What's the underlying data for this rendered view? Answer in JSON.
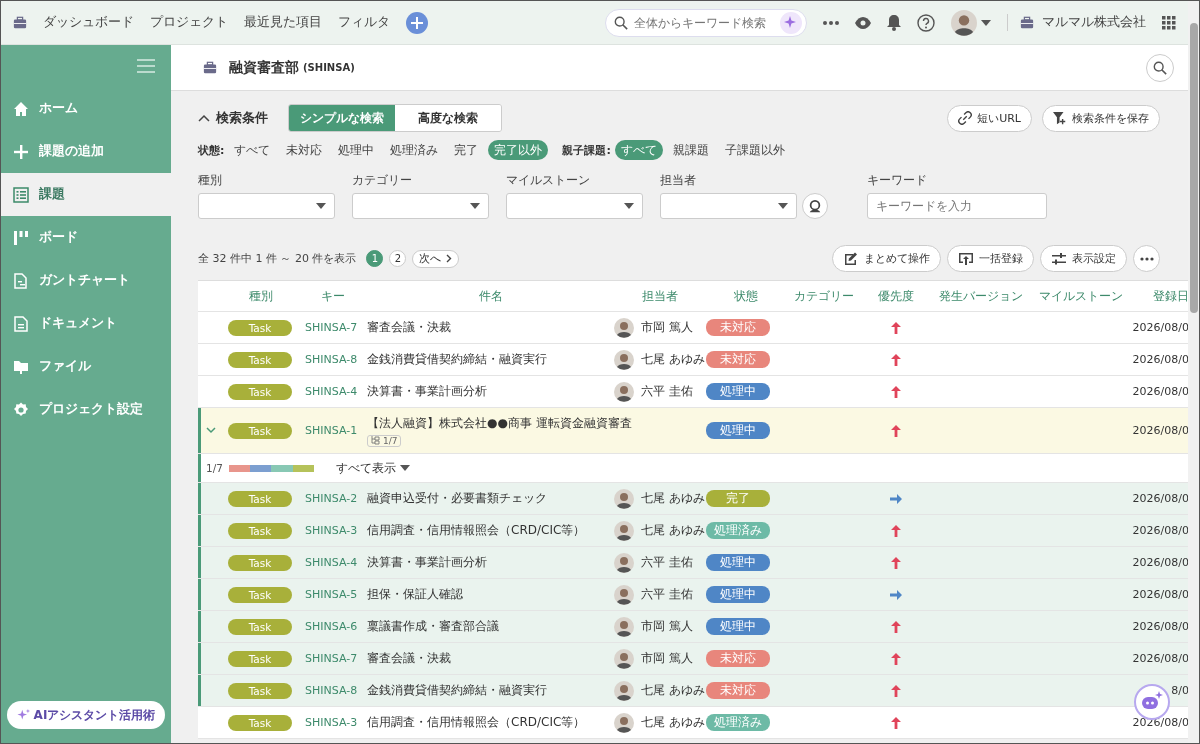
{
  "topbar": {
    "links": [
      "ダッシュボード",
      "プロジェクト",
      "最近見た項目",
      "フィルタ"
    ],
    "search": {
      "placeholder": "全体からキーワード検索"
    },
    "company": "マルマル株式会社"
  },
  "sidebar": {
    "items": [
      {
        "label": "ホーム",
        "kind": "home",
        "selected": false
      },
      {
        "label": "課題の追加",
        "kind": "add",
        "selected": false
      },
      {
        "label": "課題",
        "kind": "list",
        "selected": true
      },
      {
        "label": "ボード",
        "kind": "board",
        "selected": false
      },
      {
        "label": "ガントチャート",
        "kind": "gantt",
        "selected": false
      },
      {
        "label": "ドキュメント",
        "kind": "document",
        "selected": false
      },
      {
        "label": "ファイル",
        "kind": "file",
        "selected": false
      },
      {
        "label": "プロジェクト設定",
        "kind": "settings",
        "selected": false
      }
    ],
    "assistant": "AIアシスタント活用術"
  },
  "project": {
    "name": "融資審査部",
    "key": "(SHINSA)"
  },
  "search": {
    "title": "検索条件",
    "expanded": true,
    "modes": [
      {
        "label": "シンプルな検索",
        "selected": true
      },
      {
        "label": "高度な検索",
        "selected": false
      }
    ],
    "actions": [
      "短いURL",
      "検索条件を保存"
    ],
    "status_label": "状態:",
    "statuses": [
      {
        "label": "すべて",
        "selected": false
      },
      {
        "label": "未対応",
        "selected": false
      },
      {
        "label": "処理中",
        "selected": false
      },
      {
        "label": "処理済み",
        "selected": false
      },
      {
        "label": "完了",
        "selected": false
      },
      {
        "label": "完了以外",
        "selected": true
      }
    ],
    "parent_label": "親子課題:",
    "parents": [
      {
        "label": "すべて",
        "selected": true
      },
      {
        "label": "親課題",
        "selected": false
      },
      {
        "label": "子課題以外",
        "selected": false
      }
    ],
    "selects": [
      "種別",
      "カテゴリー",
      "マイルストーン",
      "担当者"
    ],
    "keyword": {
      "label": "キーワード",
      "placeholder": "キーワードを入力"
    }
  },
  "pager": {
    "summary": "全 32 件中 1 件 ～ 20 件を表示",
    "pages": [
      {
        "label": "1",
        "selected": true
      },
      {
        "label": "2",
        "selected": false
      }
    ],
    "next": "次へ"
  },
  "toolbar": [
    {
      "label": "まとめて操作",
      "kind": "edit"
    },
    {
      "label": "一括登録",
      "kind": "upload"
    },
    {
      "label": "表示設定",
      "kind": "sliders"
    }
  ],
  "table": {
    "columns": [
      "種別",
      "キー",
      "件名",
      "担当者",
      "状態",
      "カテゴリー",
      "優先度",
      "発生バージョン",
      "マイルストーン",
      "登録日"
    ],
    "rows": [
      {
        "type": "Task",
        "key": "SHINSA-7",
        "title": "審査会議・決裁",
        "assignee": "市岡 篤人",
        "status": "未対応",
        "color": "#e8867c",
        "priority": {
          "kind": "high"
        },
        "date": "2026/08/0"
      },
      {
        "type": "Task",
        "key": "SHINSA-8",
        "title": "金銭消費貸借契約締結・融資実行",
        "assignee": "七尾 あゆみ",
        "status": "未対応",
        "color": "#e8867c",
        "priority": {
          "kind": "high"
        },
        "date": "2026/08/0"
      },
      {
        "type": "Task",
        "key": "SHINSA-4",
        "title": "決算書・事業計画分析",
        "assignee": "六平 圭佑",
        "status": "処理中",
        "color": "#4f86c6",
        "priority": {
          "kind": "high"
        },
        "date": "2026/08/0"
      },
      {
        "type": "Task",
        "key": "SHINSA-1",
        "title": "【法人融資】株式会社●●商事 運転資金融資審査",
        "subtasks": "1/7",
        "status": "処理中",
        "color": "#4f86c6",
        "priority": {
          "kind": "high"
        },
        "date": "2026/08/0",
        "expanded": true,
        "progress": {
          "label": "1/7",
          "segments": [
            {
              "color": "#e8958c"
            },
            {
              "color": "#7c9fd0"
            },
            {
              "color": "#88c8b4"
            },
            {
              "color": "#b5c25a"
            }
          ],
          "show_all": "すべて表示"
        },
        "children": [
          {
            "type": "Task",
            "key": "SHINSA-2",
            "title": "融資申込受付・必要書類チェック",
            "assignee": "七尾 あゆみ",
            "status": "完了",
            "color": "#a8b03a",
            "priority": {
              "kind": "normal"
            },
            "date": "2026/08/0"
          },
          {
            "type": "Task",
            "key": "SHINSA-3",
            "title": "信用調査・信用情報照会（CRD/CIC等）",
            "assignee": "七尾 あゆみ",
            "status": "処理済み",
            "color": "#6dbaa6",
            "priority": {
              "kind": "high"
            },
            "date": "2026/08/0"
          },
          {
            "type": "Task",
            "key": "SHINSA-4",
            "title": "決算書・事業計画分析",
            "assignee": "六平 圭佑",
            "status": "処理中",
            "color": "#4f86c6",
            "priority": {
              "kind": "high"
            },
            "date": "2026/08/0"
          },
          {
            "type": "Task",
            "key": "SHINSA-5",
            "title": "担保・保証人確認",
            "assignee": "六平 圭佑",
            "status": "処理中",
            "color": "#4f86c6",
            "priority": {
              "kind": "normal"
            },
            "date": "2026/08/0"
          },
          {
            "type": "Task",
            "key": "SHINSA-6",
            "title": "稟議書作成・審査部合議",
            "assignee": "市岡 篤人",
            "status": "処理中",
            "color": "#4f86c6",
            "priority": {
              "kind": "high"
            },
            "date": "2026/08/0"
          },
          {
            "type": "Task",
            "key": "SHINSA-7",
            "title": "審査会議・決裁",
            "assignee": "市岡 篤人",
            "status": "未対応",
            "color": "#e8867c",
            "priority": {
              "kind": "high"
            },
            "date": "2026/08/0"
          },
          {
            "type": "Task",
            "key": "SHINSA-8",
            "title": "金銭消費貸借契約締結・融資実行",
            "assignee": "七尾 あゆみ",
            "status": "未対応",
            "color": "#e8867c",
            "priority": {
              "kind": "high"
            },
            "date": "8/0"
          }
        ]
      },
      {
        "type": "Task",
        "key": "SHINSA-3",
        "title": "信用調査・信用情報照会（CRD/CIC等）",
        "assignee": "七尾 あゆみ",
        "status": "処理済み",
        "color": "#6dbaa6",
        "priority": {
          "kind": "high"
        },
        "date": "2026/08/0"
      }
    ]
  }
}
